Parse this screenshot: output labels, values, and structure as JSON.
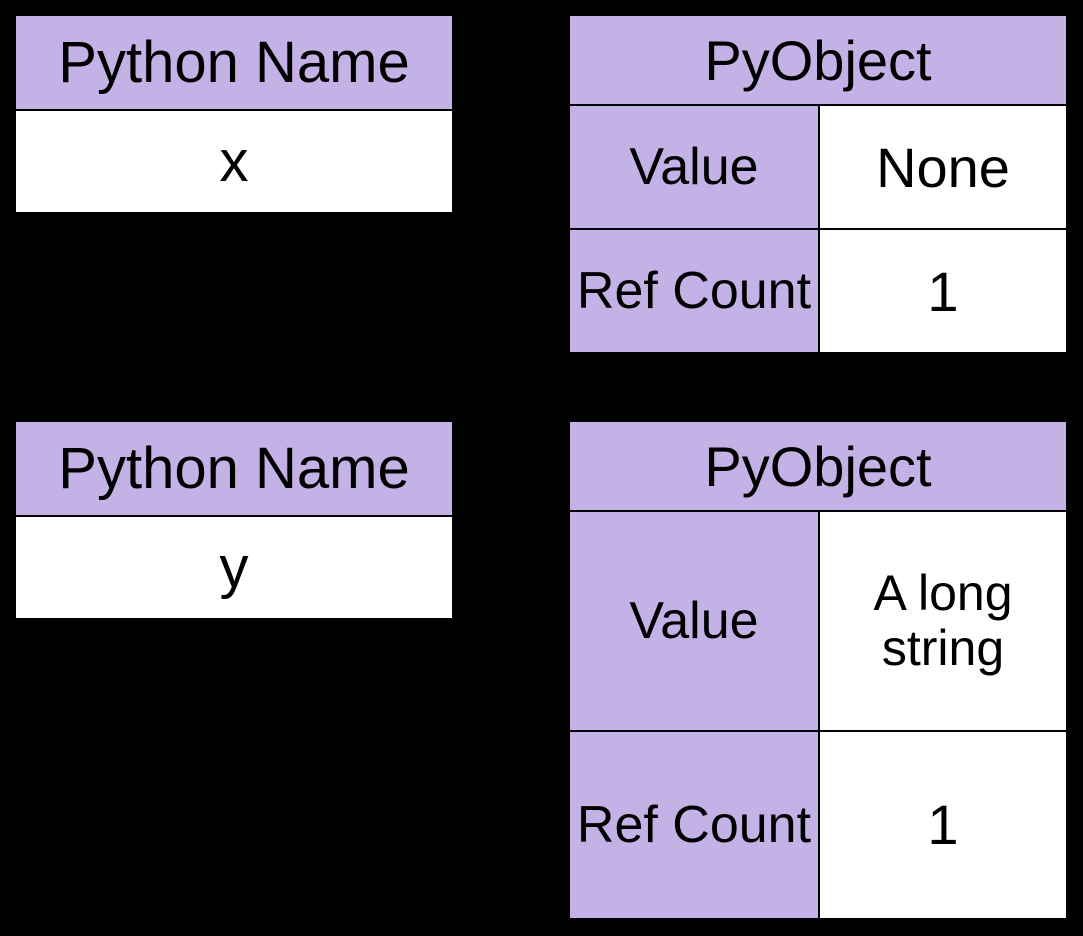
{
  "colors": {
    "accent": "#c4b2e6",
    "background": "#000000",
    "cell": "#ffffff"
  },
  "names": [
    {
      "header": "Python Name",
      "value": "x"
    },
    {
      "header": "Python Name",
      "value": "y"
    }
  ],
  "objects": [
    {
      "header": "PyObject",
      "fields": [
        {
          "label": "Value",
          "value": "None"
        },
        {
          "label": "Ref\nCount",
          "value": "1"
        }
      ]
    },
    {
      "header": "PyObject",
      "fields": [
        {
          "label": "Value",
          "value": "A long\nstring"
        },
        {
          "label": "Ref\nCount",
          "value": "1"
        }
      ]
    }
  ]
}
